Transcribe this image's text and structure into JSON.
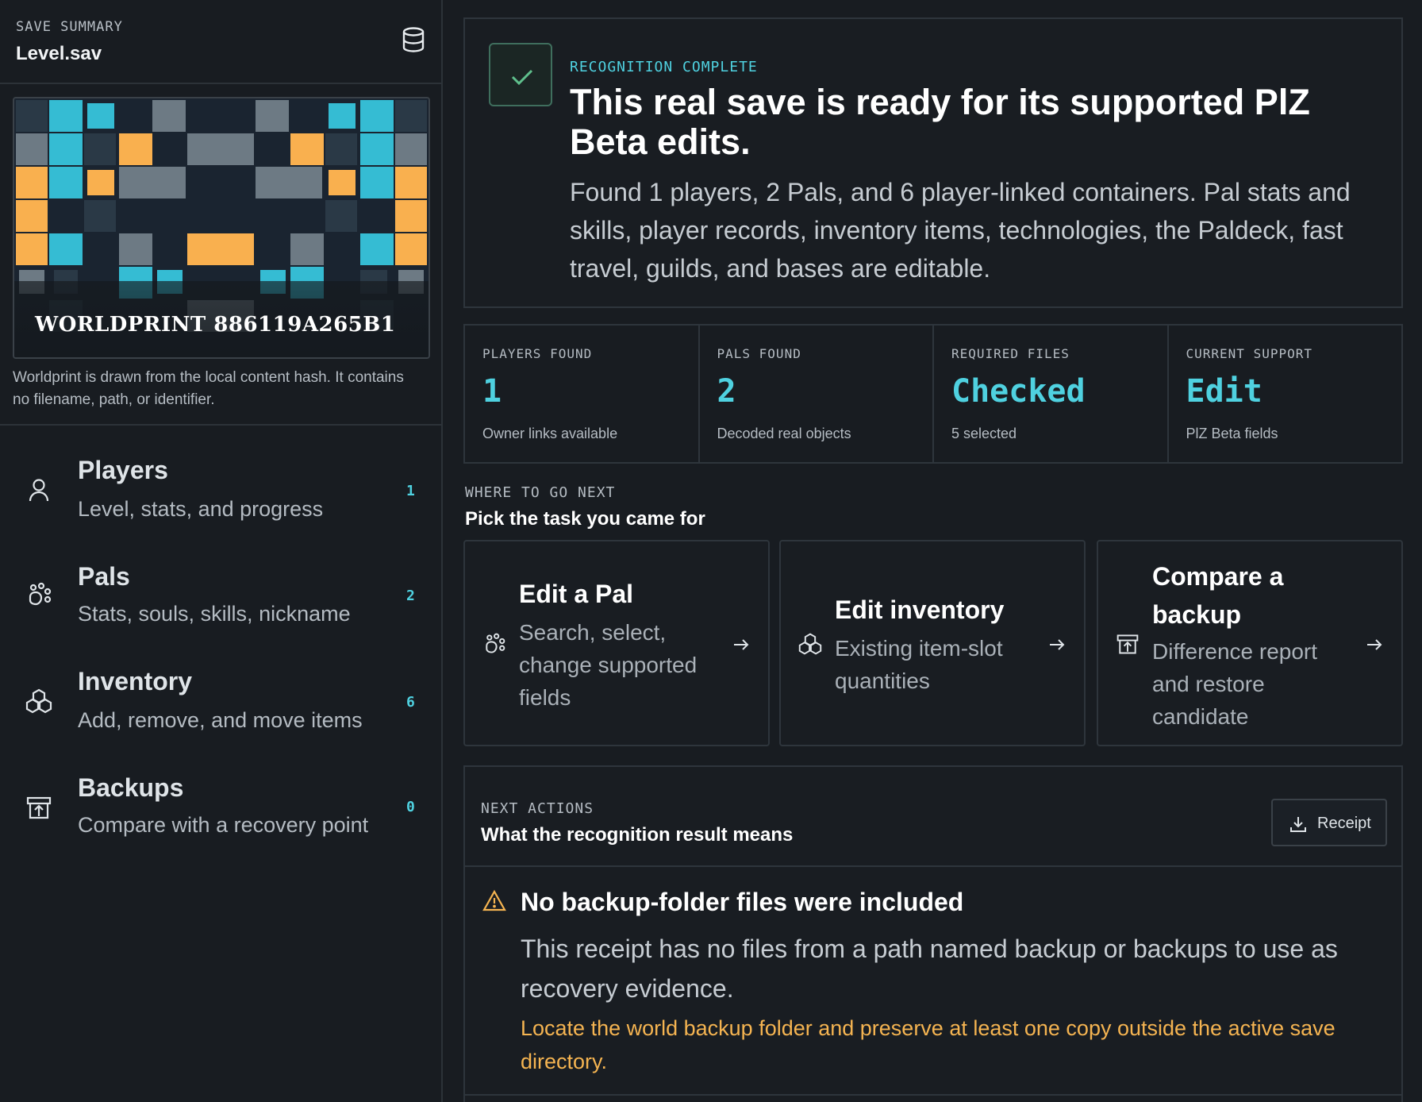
{
  "sidebar": {
    "eyebrow": "SAVE SUMMARY",
    "file_name": "Level.sav",
    "worldprint_label": "WORLDPRINT 886119A265B1",
    "worldprint_caption": "Worldprint is drawn from the local content hash. It contains no filename, path, or identifier.",
    "items": [
      {
        "icon": "user-icon",
        "title": "Players",
        "subtitle": "Level, stats, and progress",
        "count": "1"
      },
      {
        "icon": "paw-icon",
        "title": "Pals",
        "subtitle": "Stats, souls, skills, nickname",
        "count": "2"
      },
      {
        "icon": "boxes-icon",
        "title": "Inventory",
        "subtitle": "Add, remove, and move items",
        "count": "6"
      },
      {
        "icon": "archive-icon",
        "title": "Backups",
        "subtitle": "Compare with a recovery point",
        "count": "0"
      }
    ]
  },
  "hero": {
    "eyebrow": "RECOGNITION COMPLETE",
    "title": "This real save is ready for its supported PlZ Beta edits.",
    "body": "Found 1 players, 2 Pals, and 6 player-linked containers. Pal stats and skills, player records, inventory items, technologies, the Paldeck, fast travel, guilds, and bases are editable."
  },
  "stats": [
    {
      "label": "PLAYERS FOUND",
      "value": "1",
      "note": "Owner links available"
    },
    {
      "label": "PALS FOUND",
      "value": "2",
      "note": "Decoded real objects"
    },
    {
      "label": "REQUIRED FILES",
      "value": "Checked",
      "note": "5 selected"
    },
    {
      "label": "CURRENT SUPPORT",
      "value": "Edit",
      "note": "PlZ Beta fields"
    }
  ],
  "where_next": {
    "eyebrow": "WHERE TO GO NEXT",
    "title": "Pick the task you came for",
    "tasks": [
      {
        "icon": "paw-icon",
        "title": "Edit a Pal",
        "description": "Search, select, change supported fields"
      },
      {
        "icon": "boxes-icon",
        "title": "Edit inventory",
        "description": "Existing item-slot quantities"
      },
      {
        "icon": "archive-icon",
        "title": "Compare a backup",
        "description": "Difference report and restore candidate"
      }
    ]
  },
  "next_actions": {
    "eyebrow": "NEXT ACTIONS",
    "title": "What the recognition result means",
    "receipt_label": "Receipt",
    "warning_title": "No backup-folder files were included",
    "warning_body": "This receipt has no files from a path named backup or backups to use as recovery evidence.",
    "warning_action": "Locate the world backup folder and preserve at least one copy outside the active save directory."
  },
  "colors": {
    "accent": "#4fd1e0",
    "warning": "#f5b451",
    "success": "#5fbf8c",
    "worldprint_cyan": "#35bcd3",
    "worldprint_orange": "#f9b04f",
    "worldprint_gray": "#6d7a84",
    "worldprint_dark": "#1d2a36"
  }
}
